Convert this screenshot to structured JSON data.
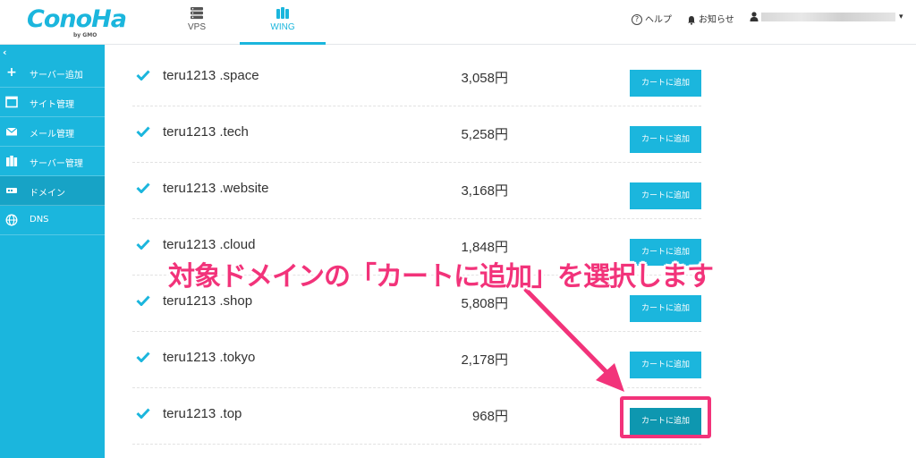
{
  "header": {
    "logo_main": "ConoHa",
    "logo_sub": "by GMO",
    "tabs": [
      {
        "label": "VPS",
        "icon": "server-icon"
      },
      {
        "label": "WING",
        "icon": "wing-icon"
      }
    ],
    "help_label": "ヘルプ",
    "notice_label": "お知らせ"
  },
  "sidebar": {
    "items": [
      {
        "label": "サーバー追加",
        "icon": "plus-icon"
      },
      {
        "label": "サイト管理",
        "icon": "window-icon"
      },
      {
        "label": "メール管理",
        "icon": "mail-icon"
      },
      {
        "label": "サーバー管理",
        "icon": "server-manage-icon"
      },
      {
        "label": "ドメイン",
        "icon": "domain-icon"
      },
      {
        "label": "DNS",
        "icon": "globe-icon"
      }
    ],
    "active_index": 4
  },
  "domains": [
    {
      "name": "teru1213 .space",
      "price": "3,058円",
      "button": "カートに追加"
    },
    {
      "name": "teru1213 .tech",
      "price": "5,258円",
      "button": "カートに追加"
    },
    {
      "name": "teru1213 .website",
      "price": "3,168円",
      "button": "カートに追加"
    },
    {
      "name": "teru1213 .cloud",
      "price": "1,848円",
      "button": "カートに追加"
    },
    {
      "name": "teru1213 .shop",
      "price": "5,808円",
      "button": "カートに追加"
    },
    {
      "name": "teru1213 .tokyo",
      "price": "2,178円",
      "button": "カートに追加"
    },
    {
      "name": "teru1213 .top",
      "price": "968円",
      "button": "カートに追加"
    }
  ],
  "annotation": {
    "text": "対象ドメインの「カートに追加」を選択します",
    "color": "#f2337a"
  },
  "colors": {
    "accent": "#1bb6dd",
    "highlight": "#f2337a"
  }
}
